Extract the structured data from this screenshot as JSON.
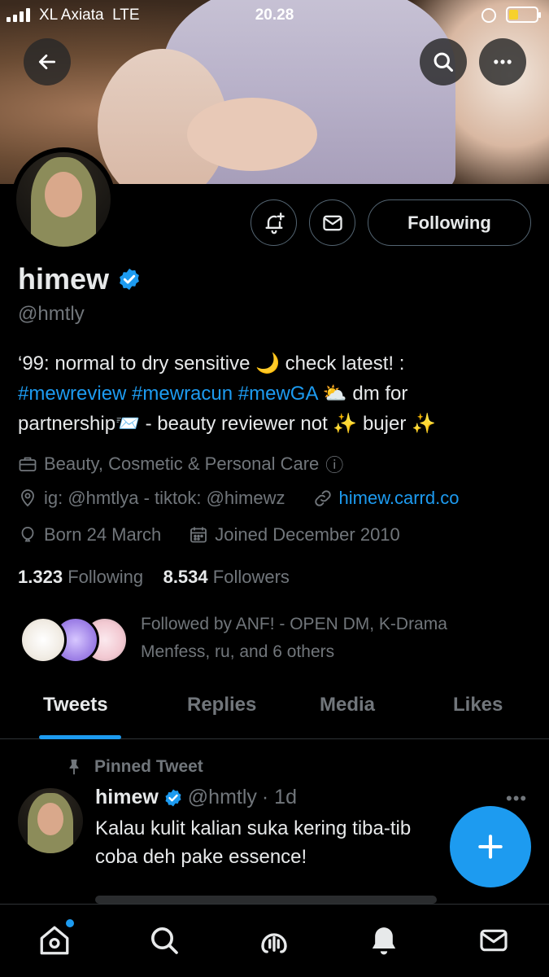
{
  "status_bar": {
    "carrier": "XL Axiata",
    "network": "LTE",
    "time": "20.28",
    "battery_color": "#f7d12c"
  },
  "header": {
    "back_icon": "arrow-left-icon",
    "search_icon": "search-icon",
    "more_icon": "more-horizontal-icon"
  },
  "profile": {
    "display_name": "himew",
    "handle": "@hmtly",
    "verified": true,
    "verified_color": "#1d9bf0",
    "follow_button_label": "Following",
    "bio_line1": "‘99: normal to dry sensitive 🌙 check latest! :",
    "bio_tag1": "#mewreview",
    "bio_tag2": "#mewracun",
    "bio_tag3": "#mewGA",
    "bio_line2_tail": "⛅ dm for",
    "bio_line3": "partnership📨 - beauty reviewer not ✨ bujer ✨",
    "category": "Beauty, Cosmetic & Personal Care",
    "category_info": "ⓘ",
    "location": "ig: @hmtlya - tiktok: @himewz",
    "website": "himew.carrd.co",
    "birthday": "Born 24 March",
    "joined": "Joined December 2010",
    "following_count": "1.323",
    "following_label": "Following",
    "followers_count": "8.534",
    "followers_label": "Followers",
    "followed_by_line1": "Followed by ANF! - OPEN DM, K-Drama",
    "followed_by_line2": "Menfess, ru, and 6 others"
  },
  "tabs": [
    {
      "label": "Tweets",
      "active": true
    },
    {
      "label": "Replies",
      "active": false
    },
    {
      "label": "Media",
      "active": false
    },
    {
      "label": "Likes",
      "active": false
    }
  ],
  "pinned_tweet": {
    "pinned_label": "Pinned Tweet",
    "name": "himew",
    "handle": "@hmtly",
    "time": "· 1d",
    "more": "•••",
    "text_line1": "Kalau kulit kalian suka kering tiba-tib",
    "text_line2": "coba deh pake essence!"
  },
  "fab": {
    "icon": "plus-icon",
    "color": "#1d9bf0"
  },
  "bottom_nav": [
    {
      "icon": "home-icon",
      "has_dot": true
    },
    {
      "icon": "search-icon"
    },
    {
      "icon": "spaces-icon"
    },
    {
      "icon": "bell-icon"
    },
    {
      "icon": "mail-icon"
    }
  ],
  "colors": {
    "background": "#000000",
    "text_primary": "#e7e9ea",
    "text_secondary": "#71767b",
    "accent": "#1d9bf0",
    "border": "#536471"
  }
}
